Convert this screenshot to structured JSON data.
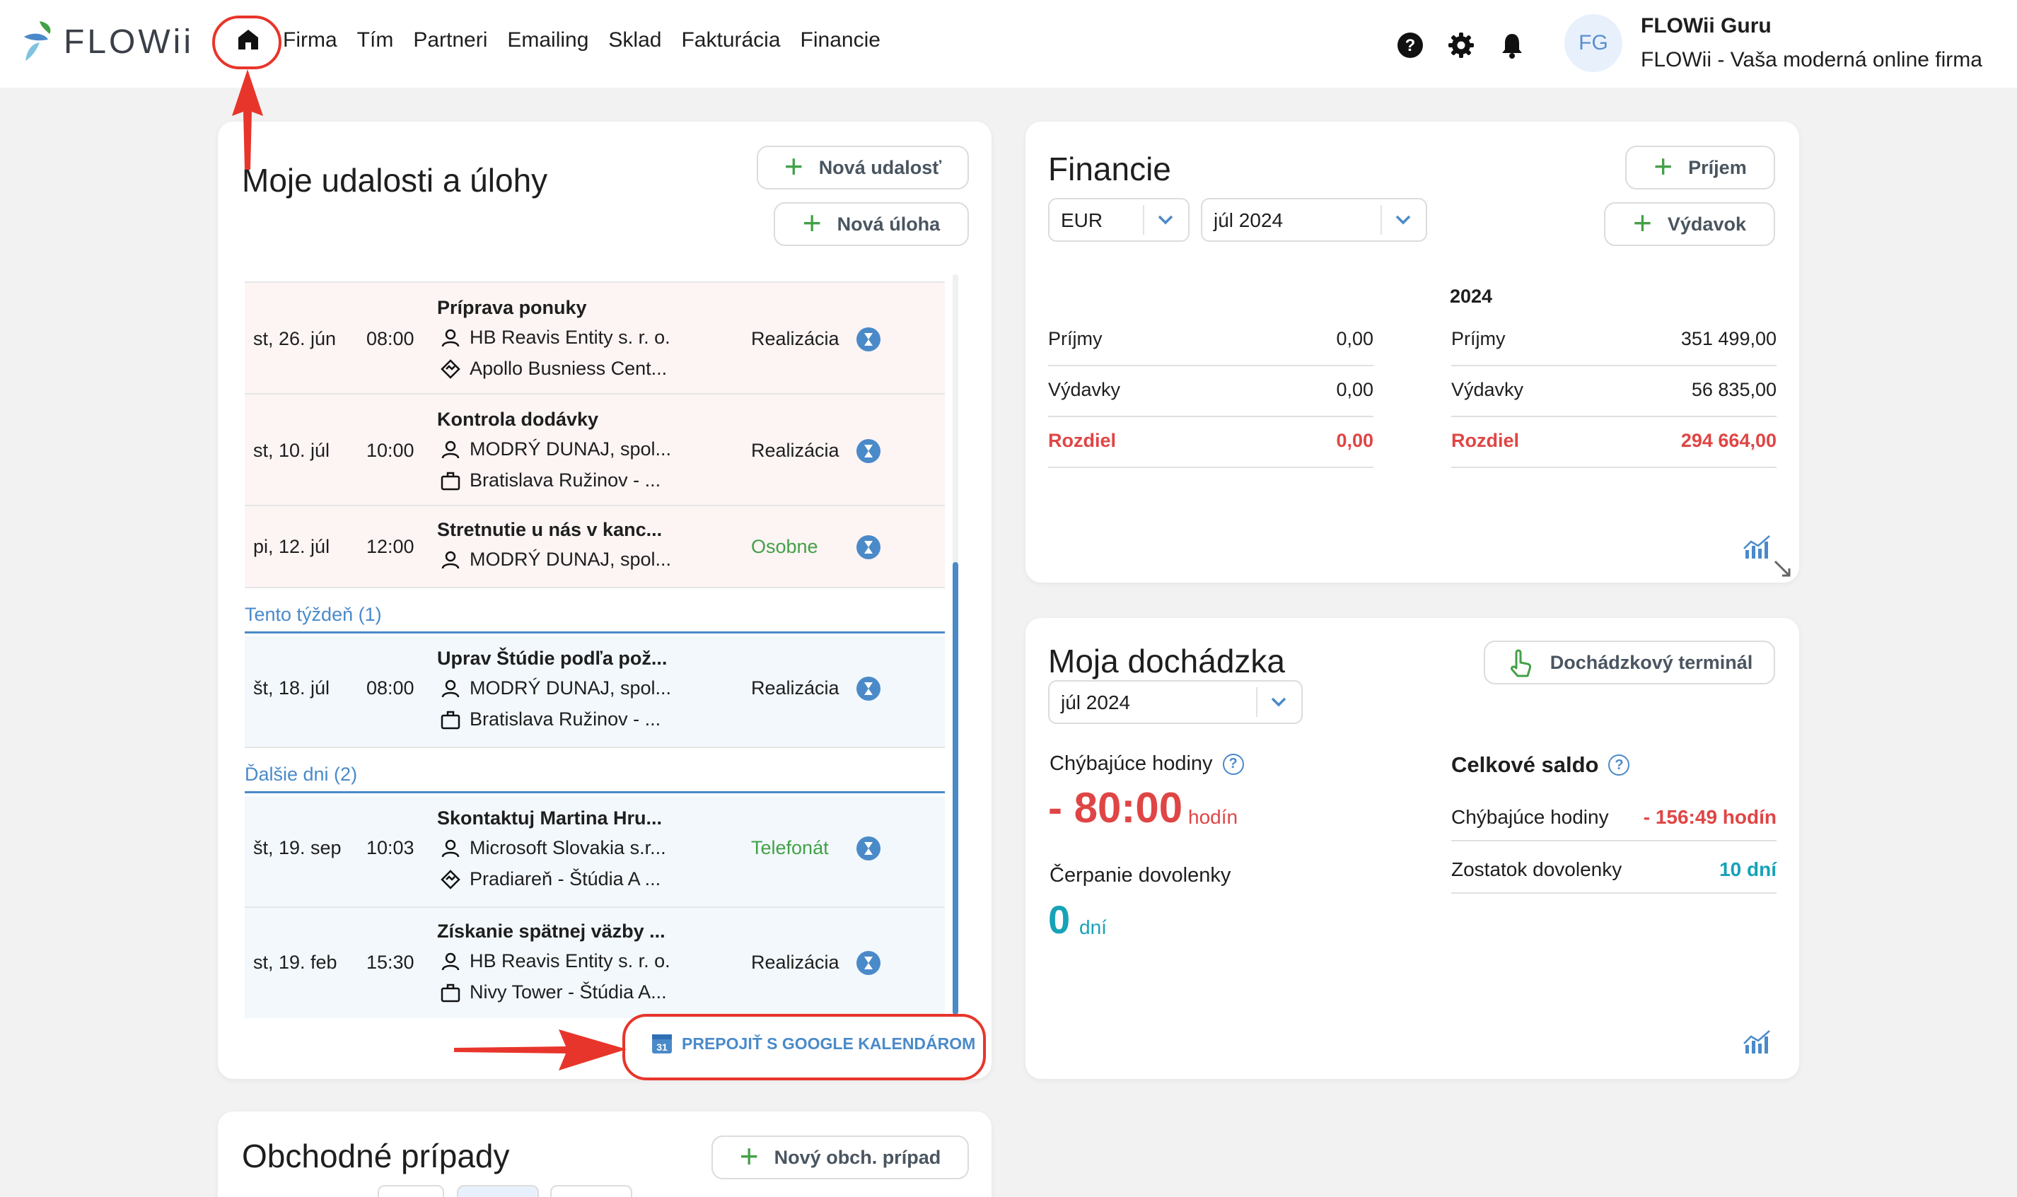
{
  "header": {
    "logo_text": "FLOWii",
    "nav": [
      "Firma",
      "Tím",
      "Partneri",
      "Emailing",
      "Sklad",
      "Fakturácia",
      "Financie"
    ],
    "avatar_initials": "FG",
    "user_name": "FLOWii Guru",
    "user_company": "FLOWii - Vaša moderná online firma"
  },
  "events_card": {
    "title": "Moje udalosti a úlohy",
    "new_event_label": "Nová udalosť",
    "new_task_label": "Nová úloha",
    "groups": [
      {
        "header": "",
        "items": [
          {
            "date": "st, 26. jún",
            "time": "08:00",
            "title": "Príprava ponuky",
            "partner": "HB Reavis Entity s. r. o.",
            "place": "Apollo Busniess Cent...",
            "place_icon": "handshake-icon",
            "type": "Realizácia",
            "type_color": "#1e1e1e"
          },
          {
            "date": "st, 10. júl",
            "time": "10:00",
            "title": "Kontrola dodávky",
            "partner": "MODRÝ DUNAJ, spol...",
            "place": "Bratislava Ružinov - ...",
            "place_icon": "briefcase-icon",
            "type": "Realizácia",
            "type_color": "#1e1e1e"
          },
          {
            "date": "pi, 12. júl",
            "time": "12:00",
            "title": "Stretnutie u nás v kanc...",
            "partner": "MODRÝ DUNAJ, spol...",
            "place": "",
            "place_icon": "",
            "type": "Osobne",
            "type_color": "#43a047"
          }
        ]
      },
      {
        "header": "Tento týždeň (1)",
        "items": [
          {
            "date": "št, 18. júl",
            "time": "08:00",
            "title": "Uprav Štúdie podľa pož...",
            "partner": "MODRÝ DUNAJ, spol...",
            "place": "Bratislava Ružinov - ...",
            "place_icon": "briefcase-icon",
            "type": "Realizácia",
            "type_color": "#1e1e1e"
          }
        ]
      },
      {
        "header": "Ďalšie dni (2)",
        "items": [
          {
            "date": "št, 19. sep",
            "time": "10:03",
            "title": "Skontaktuj Martina Hru...",
            "partner": "Microsoft Slovakia s.r...",
            "place": "Pradiareň - Štúdia A ...",
            "place_icon": "handshake-icon",
            "type": "Telefonát",
            "type_color": "#43a047"
          },
          {
            "date": "st, 19. feb",
            "time": "15:30",
            "title": "Získanie spätnej väzby ...",
            "partner": "HB Reavis Entity s. r. o.",
            "place": "Nivy Tower - Štúdia A...",
            "place_icon": "briefcase-icon",
            "type": "Realizácia",
            "type_color": "#1e1e1e"
          }
        ]
      }
    ],
    "google_link": "PREPOJIŤ S GOOGLE KALENDÁROM",
    "gcal_icon_text": "31"
  },
  "deals_card": {
    "title": "Obchodné prípady",
    "new_deal_label": "Nový obch. prípad"
  },
  "finance_card": {
    "title": "Financie",
    "income_label": "Príjem",
    "expense_label": "Výdavok",
    "currency": "EUR",
    "period": "júl 2024",
    "year_header": "2024",
    "month_rows": [
      {
        "label": "Príjmy",
        "value": "0,00"
      },
      {
        "label": "Výdavky",
        "value": "0,00"
      },
      {
        "label": "Rozdiel",
        "value": "0,00"
      }
    ],
    "year_rows": [
      {
        "label": "Príjmy",
        "value": "351 499,00"
      },
      {
        "label": "Výdavky",
        "value": "56 835,00"
      },
      {
        "label": "Rozdiel",
        "value": "294 664,00"
      }
    ]
  },
  "attendance_card": {
    "title": "Moja dochádzka",
    "terminal_label": "Dochádzkový terminál",
    "period": "júl 2024",
    "missing_hours_label": "Chýbajúce hodiny",
    "missing_hours_value": "- 80:00",
    "missing_hours_unit": "hodín",
    "vacation_used_label": "Čerpanie dovolenky",
    "vacation_used_value": "0",
    "vacation_used_unit": "dní",
    "total_title": "Celkové saldo",
    "total_rows": [
      {
        "label": "Chýbajúce hodiny",
        "value": "- 156:49 hodín",
        "color": "#e04545"
      },
      {
        "label": "Zostatok dovolenky",
        "value": "10 dní",
        "color": "#17a2b8"
      }
    ]
  },
  "colors": {
    "accent_blue": "#4a8ac9",
    "green": "#43a047",
    "red": "#e04545",
    "teal": "#17a2b8",
    "annotation_red": "#e8352b"
  }
}
